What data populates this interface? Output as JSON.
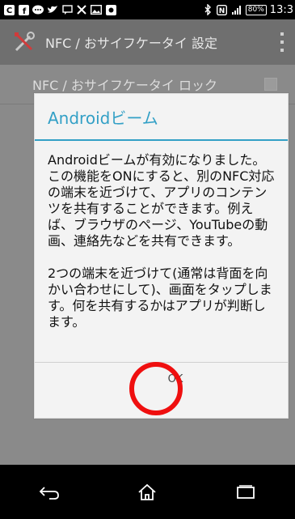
{
  "status_bar": {
    "battery": "80%",
    "clock": "13:3"
  },
  "action_bar": {
    "title": "NFC / おサイフケータイ 設定",
    "settings_icon": "tools-icon",
    "overflow_icon": "overflow-menu-icon"
  },
  "list": {
    "lock_item_label": "NFC / おサイフケータイ ロック"
  },
  "dialog": {
    "title": "Androidビーム",
    "paragraph1": "Androidビームが有効になりました。この機能をONにすると、別のNFC対応の端末を近づけて、アプリのコンテンツを共有することができます。例えば、ブラウザのページ、YouTubeの動画、連絡先などを共有できます。",
    "paragraph2": "2つの端末を近づけて(通常は背面を向かい合わせにして)、画面をタップします。何を共有するかはアプリが判断します。",
    "ok_label": "OK"
  },
  "highlight": {
    "color": "#ef0f0f"
  },
  "nav_bar": {
    "back_icon": "back-icon",
    "home_icon": "home-icon",
    "recents_icon": "recents-icon"
  },
  "colors": {
    "accent": "#33a0c6"
  }
}
